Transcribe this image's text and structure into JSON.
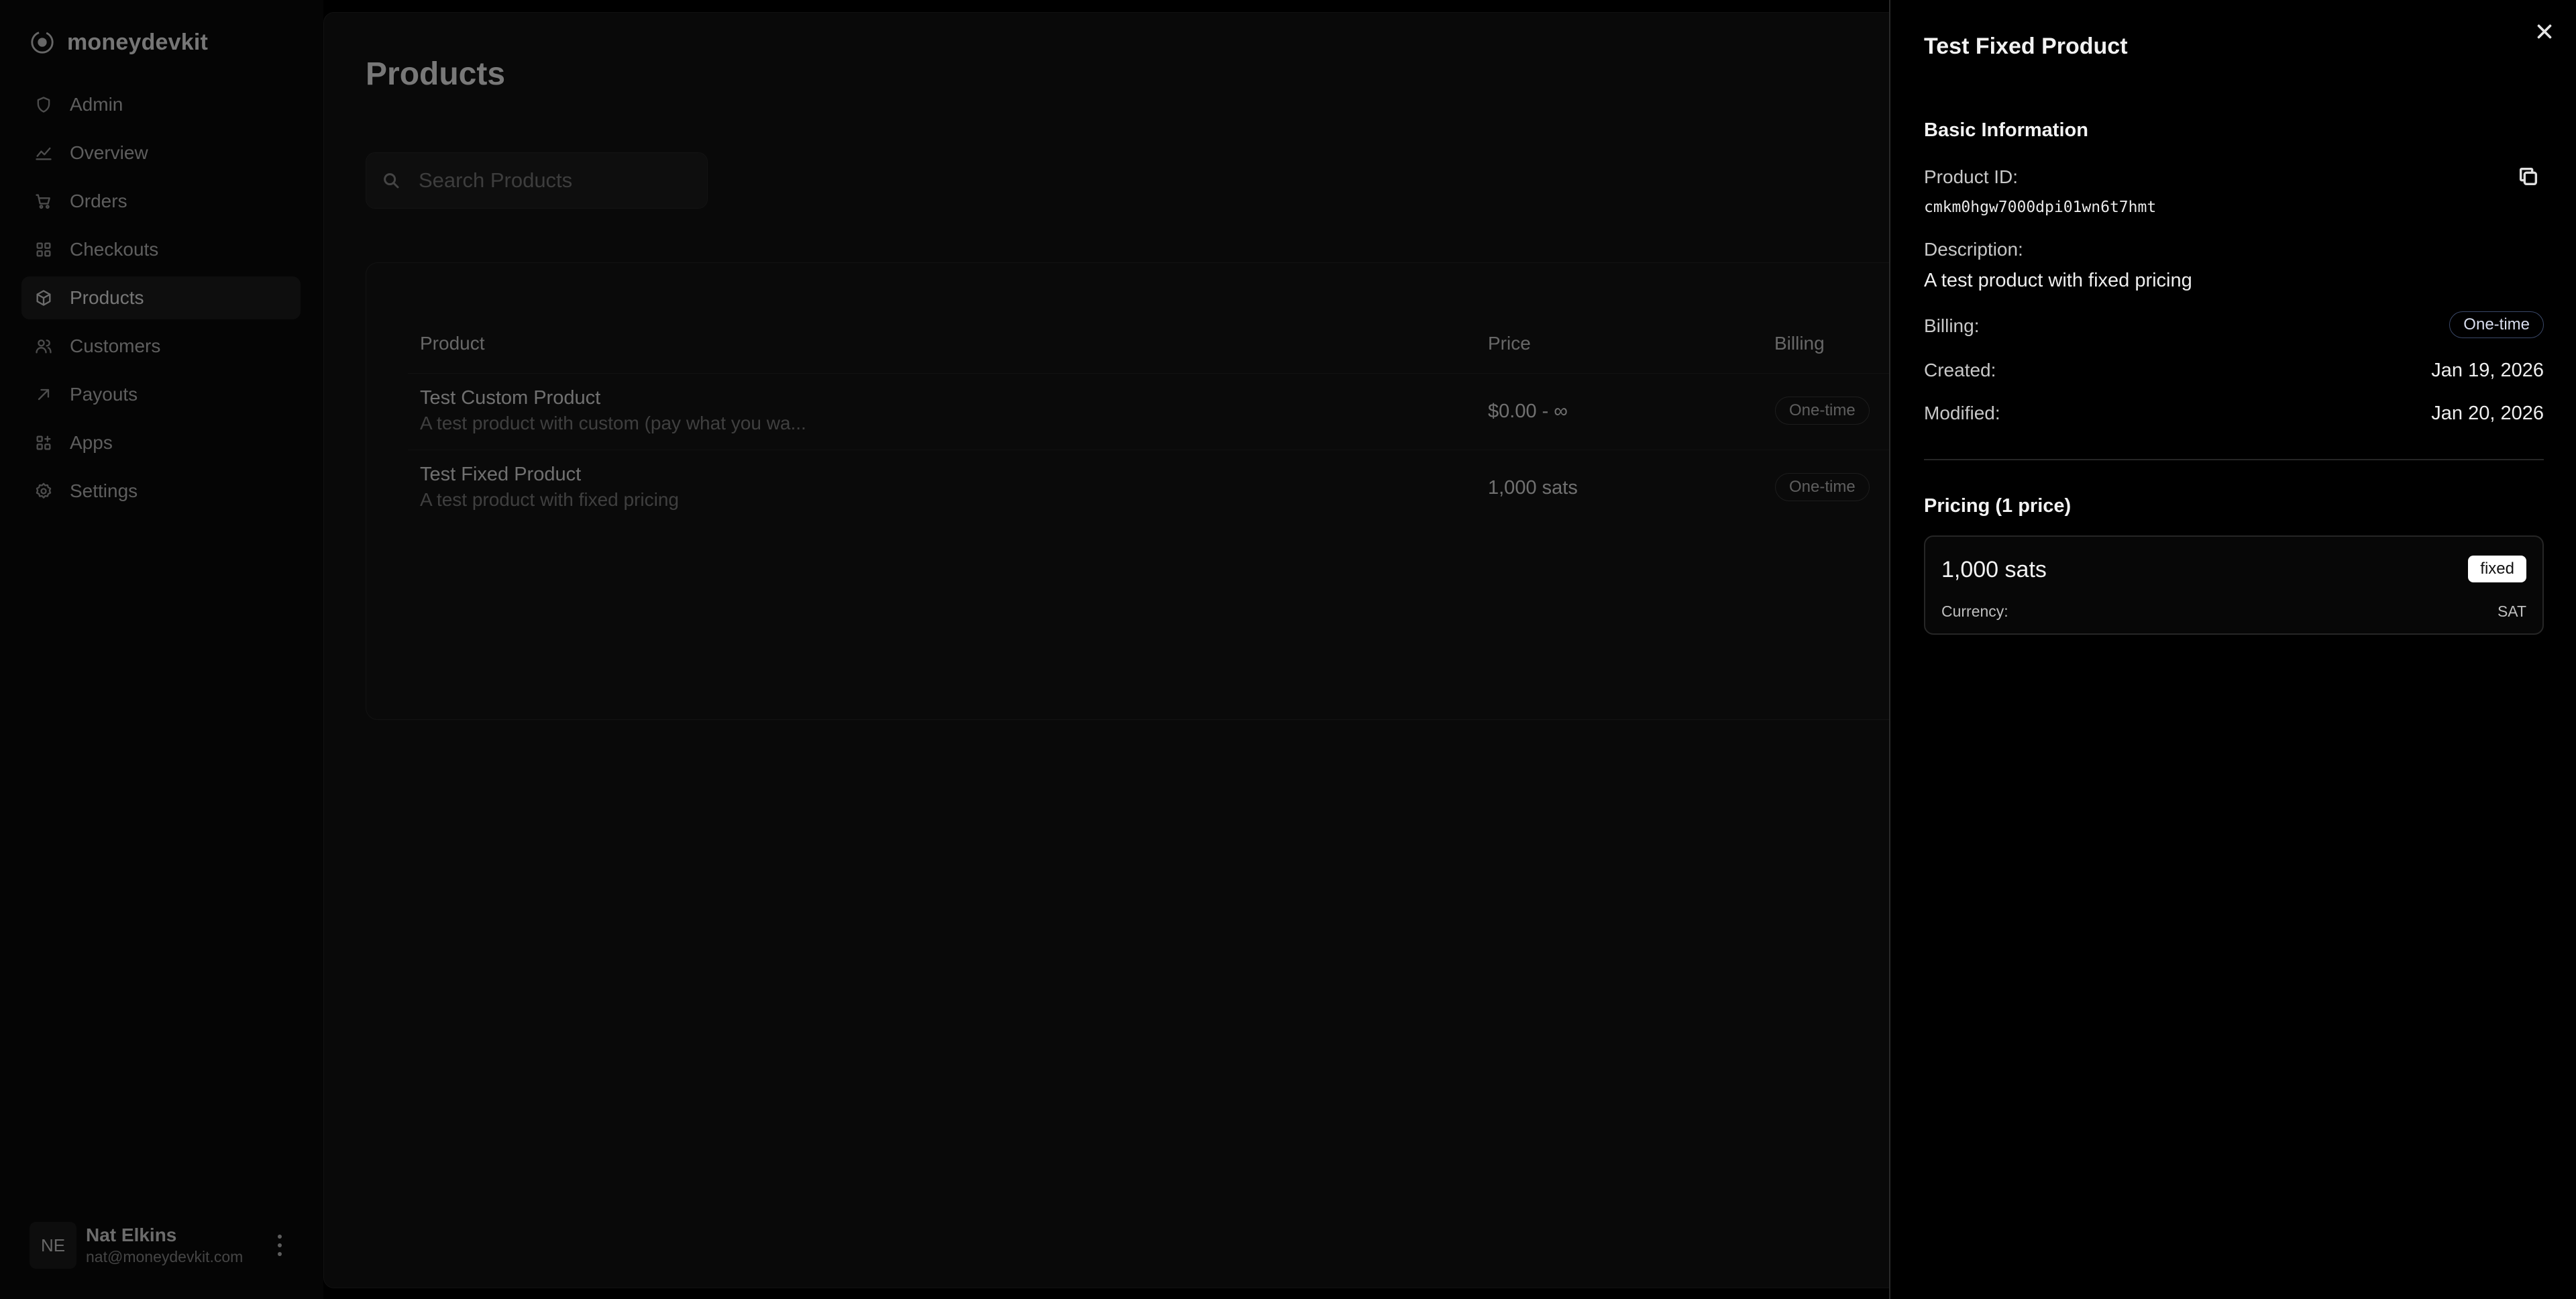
{
  "app": {
    "name": "moneydevkit"
  },
  "sidebar": {
    "items": [
      {
        "label": "Admin",
        "icon": "shield-icon",
        "active": false
      },
      {
        "label": "Overview",
        "icon": "chart-icon",
        "active": false
      },
      {
        "label": "Orders",
        "icon": "cart-icon",
        "active": false
      },
      {
        "label": "Checkouts",
        "icon": "grid-icon",
        "active": false
      },
      {
        "label": "Products",
        "icon": "box-icon",
        "active": true
      },
      {
        "label": "Customers",
        "icon": "users-icon",
        "active": false
      },
      {
        "label": "Payouts",
        "icon": "arrow-up-right-icon",
        "active": false
      },
      {
        "label": "Apps",
        "icon": "apps-icon",
        "active": false
      },
      {
        "label": "Settings",
        "icon": "gear-icon",
        "active": false
      }
    ],
    "user": {
      "initials": "NE",
      "name": "Nat Elkins",
      "email": "nat@moneydevkit.com"
    }
  },
  "main": {
    "title": "Products",
    "search": {
      "placeholder": "Search Products",
      "value": ""
    },
    "table": {
      "headers": [
        "Product",
        "Price",
        "Billing"
      ],
      "rows": [
        {
          "name": "Test Custom Product",
          "description": "A test product with custom (pay what you wa...",
          "price": "$0.00 - ∞",
          "billing": "One-time"
        },
        {
          "name": "Test Fixed Product",
          "description": "A test product with fixed pricing",
          "price": "1,000 sats",
          "billing": "One-time"
        }
      ]
    }
  },
  "drawer": {
    "title": "Test Fixed Product",
    "basic_section": "Basic Information",
    "product_id_label": "Product ID:",
    "product_id": "cmkm0hgw7000dpi01wn6t7hmt",
    "description_label": "Description:",
    "description": "A test product with fixed pricing",
    "billing_label": "Billing:",
    "billing": "One-time",
    "created_label": "Created:",
    "created": "Jan 19, 2026",
    "modified_label": "Modified:",
    "modified": "Jan 20, 2026",
    "pricing_section": "Pricing (1 price)",
    "price": {
      "amount": "1,000 sats",
      "type": "fixed",
      "currency_label": "Currency:",
      "currency": "SAT"
    }
  }
}
